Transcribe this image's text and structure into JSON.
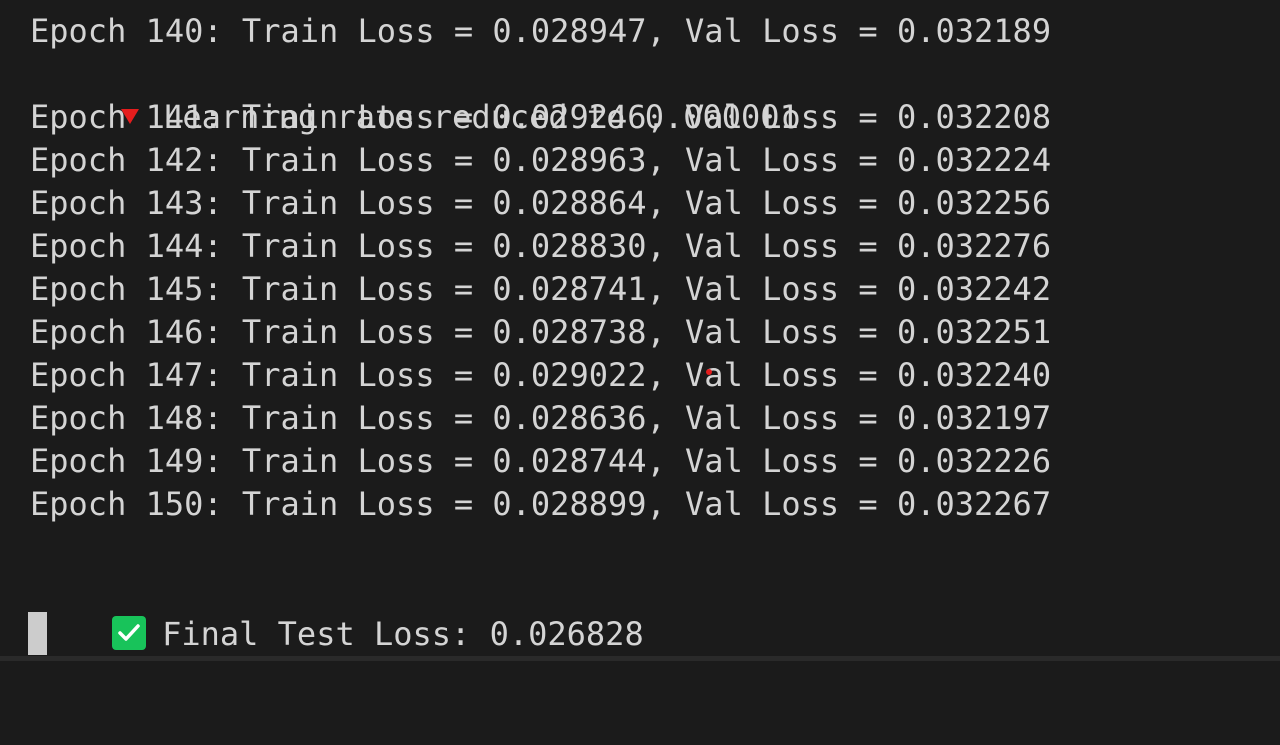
{
  "terminal": {
    "lines": [
      {
        "text": "Epoch 140: Train Loss = 0.028947, Val Loss = 0.032189"
      },
      {
        "text": "Learning rate reduced to 0.000001",
        "icon": "red-down-triangle-icon"
      },
      {
        "text": "Epoch 141: Train Loss = 0.029246, Val Loss = 0.032208"
      },
      {
        "text": "Epoch 142: Train Loss = 0.028963, Val Loss = 0.032224"
      },
      {
        "text": "Epoch 143: Train Loss = 0.028864, Val Loss = 0.032256"
      },
      {
        "text": "Epoch 144: Train Loss = 0.028830, Val Loss = 0.032276"
      },
      {
        "text": "Epoch 145: Train Loss = 0.028741, Val Loss = 0.032242"
      },
      {
        "text": "Epoch 146: Train Loss = 0.028738, Val Loss = 0.032251"
      },
      {
        "text": "Epoch 147: Train Loss = 0.029022, Val Loss = 0.032240"
      },
      {
        "text": "Epoch 148: Train Loss = 0.028636, Val Loss = 0.032197"
      },
      {
        "text": "Epoch 149: Train Loss = 0.028744, Val Loss = 0.032226"
      },
      {
        "text": "Epoch 150: Train Loss = 0.028899, Val Loss = 0.032267"
      }
    ],
    "final": {
      "text": "Final Test Loss: 0.026828",
      "icon": "green-check-icon"
    }
  },
  "colors": {
    "background": "#1b1b1b",
    "text": "#d4d4d4",
    "warning_icon": "#e51d1d",
    "success_icon": "#18c35a",
    "cursor": "#cccccc"
  }
}
